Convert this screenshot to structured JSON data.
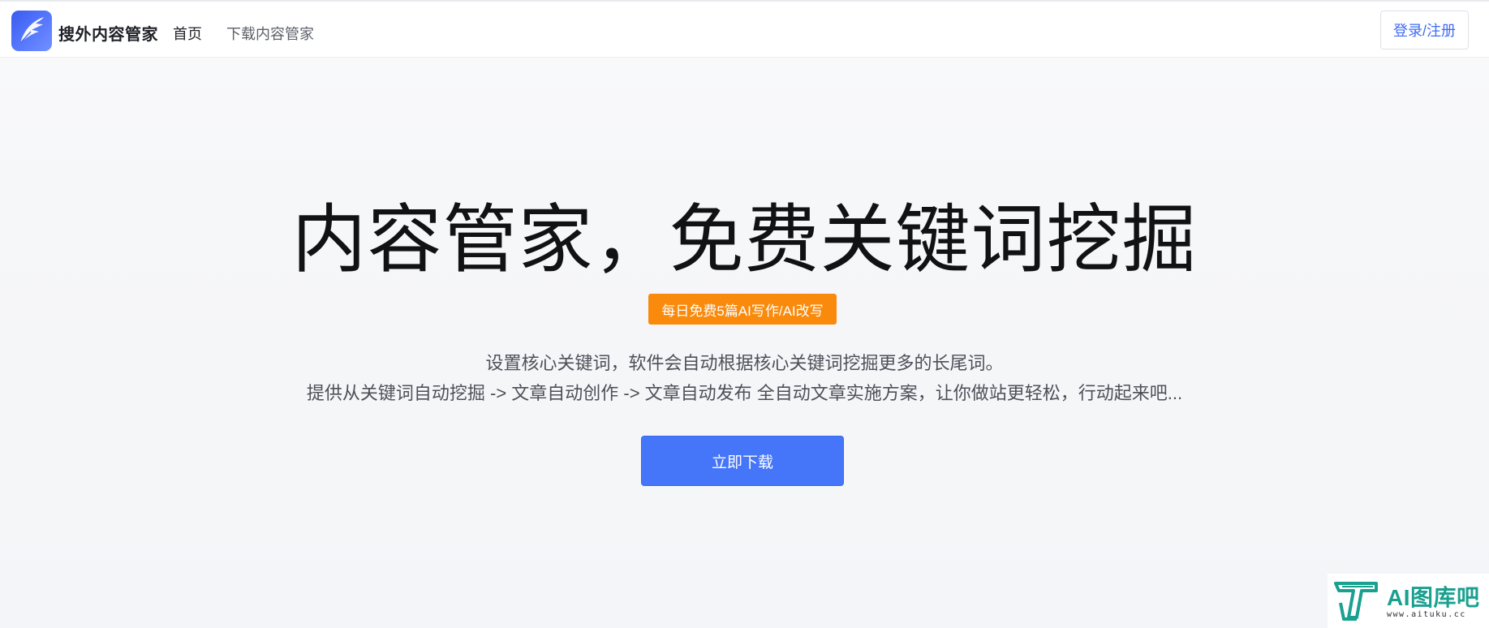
{
  "header": {
    "brand": "搜外内容管家",
    "logo_icon": "feather-icon",
    "nav": {
      "home": "首页",
      "download": "下载内容管家"
    },
    "login_label": "登录/注册"
  },
  "hero": {
    "title": "内容管家，免费关键词挖掘",
    "badge": "每日免费5篇AI写作/AI改写",
    "description_line1": "设置核心关键词，软件会自动根据核心关键词挖掘更多的长尾词。",
    "description_line2": "提供从关键词自动挖掘 -> 文章自动创作 -> 文章自动发布 全自动文章实施方案，让你做站更轻松，行动起来吧...",
    "download_label": "立即下载"
  },
  "watermark": {
    "icon": "aituku-logo-icon",
    "text": "AI图库吧",
    "url": "www.aituku.cc"
  },
  "colors": {
    "accent": "#4576fa",
    "badge": "#f98a0c",
    "login_text": "#3f6cf2",
    "watermark": "#1aa08f"
  }
}
